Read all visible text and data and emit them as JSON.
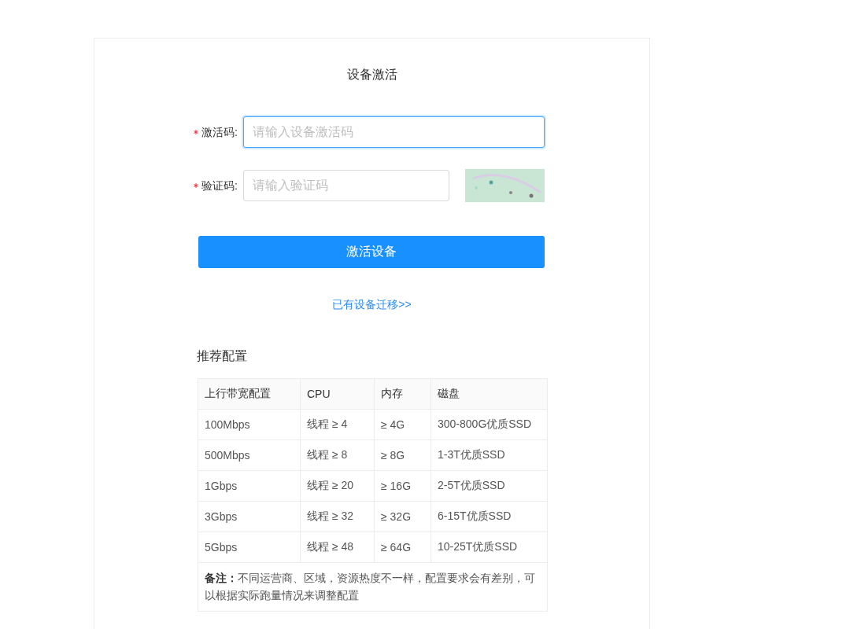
{
  "card": {
    "title": "设备激活"
  },
  "form": {
    "fields": [
      {
        "kind": "text",
        "label": "激活码:",
        "required": true,
        "placeholder": "请输入设备激活码",
        "focused": true
      },
      {
        "kind": "captcha",
        "label": "验证码:",
        "required": true,
        "placeholder": "请输入验证码",
        "focused": false
      }
    ],
    "submit_button": "激活设备",
    "migrate_link": "已有设备迁移>>"
  },
  "recommended": {
    "title": "推荐配置",
    "columns": [
      "上行带宽配置",
      "CPU",
      "内存",
      "磁盘"
    ],
    "rows": [
      [
        "100Mbps",
        "线程 ≥ 4",
        "≥ 4G",
        "300-800G优质SSD"
      ],
      [
        "500Mbps",
        "线程 ≥ 8",
        "≥ 8G",
        "1-3T优质SSD"
      ],
      [
        "1Gbps",
        "线程 ≥ 20",
        "≥ 16G",
        "2-5T优质SSD"
      ],
      [
        "3Gbps",
        "线程 ≥ 32",
        "≥ 32G",
        "6-15T优质SSD"
      ],
      [
        "5Gbps",
        "线程 ≥ 48",
        "≥ 64G",
        "10-25T优质SSD"
      ]
    ],
    "note": "**备注：**不同运营商、区域，资源热度不一样，配置要求会有差别，可以根据实际跑量情况来调整配置"
  }
}
